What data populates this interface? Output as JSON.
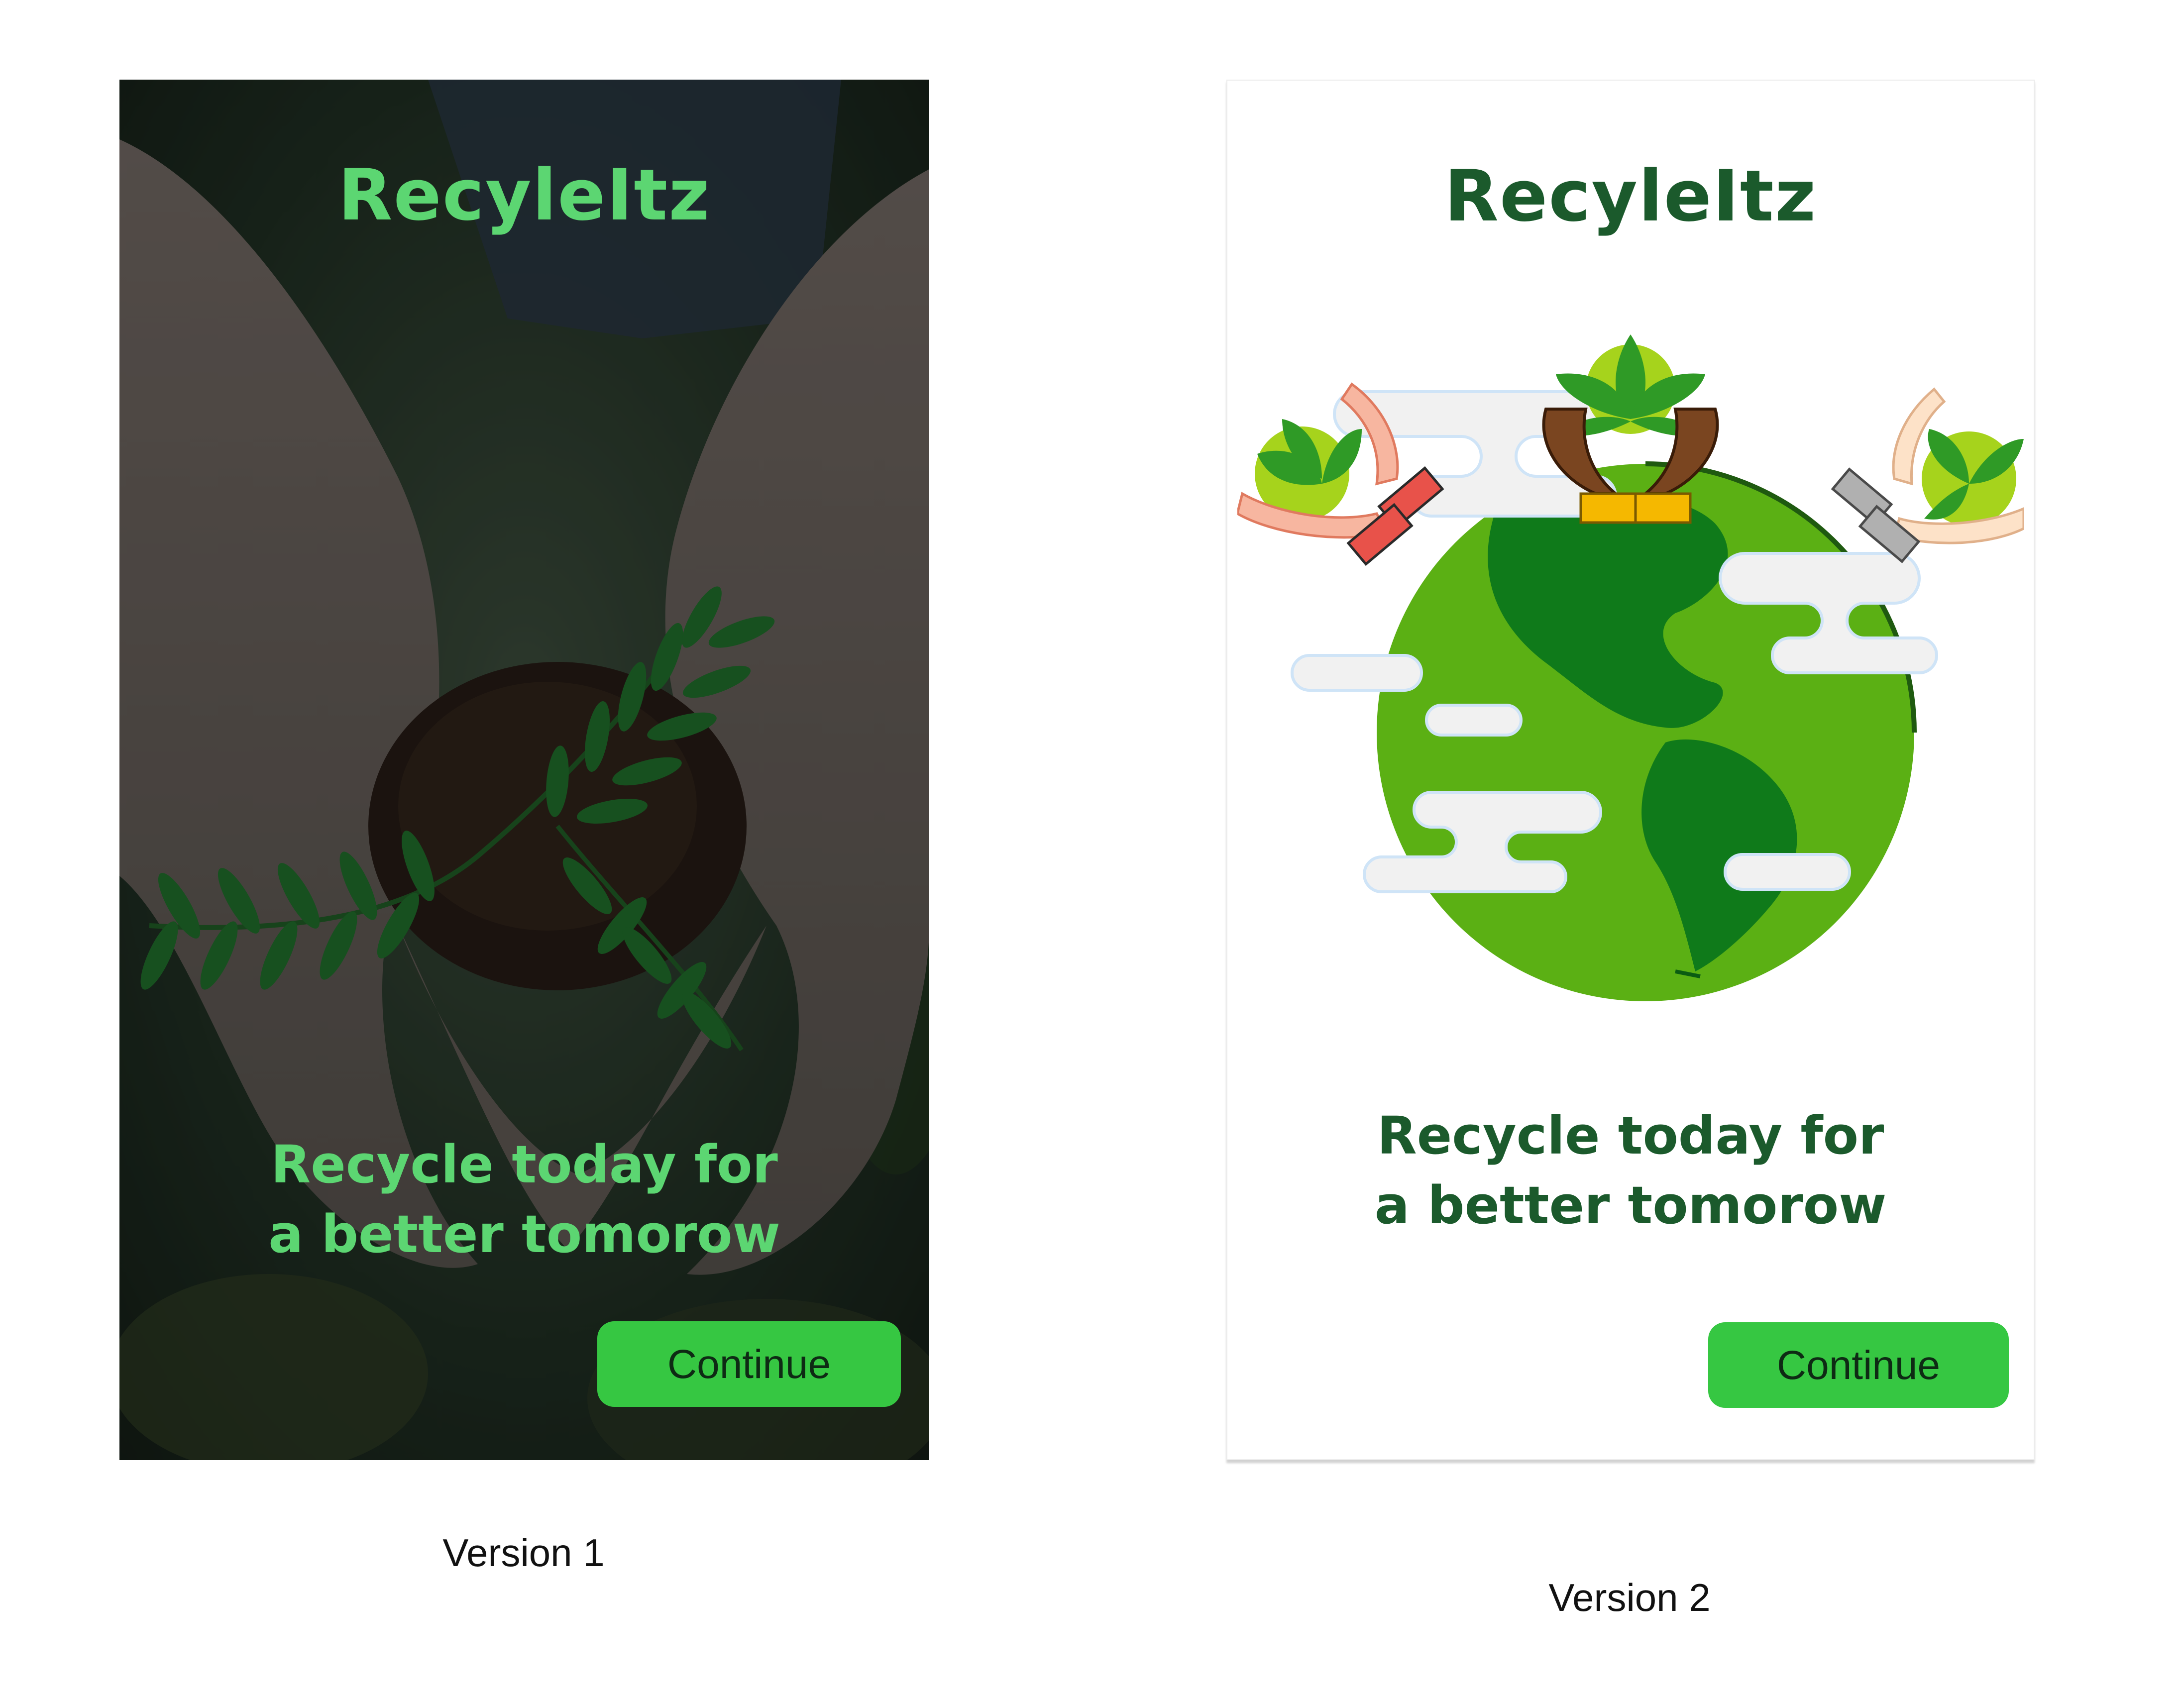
{
  "versions": [
    {
      "app_title": "RecyleItz",
      "tagline_line1": "Recycle today for",
      "tagline_line2": "a better tomorow",
      "continue_label": "Continue",
      "caption": "Version 1"
    },
    {
      "app_title": "RecyleItz",
      "tagline_line1": "Recycle today for",
      "tagline_line2": "a better tomorow",
      "continue_label": "Continue",
      "caption": "Version 2"
    }
  ],
  "colors": {
    "v1_title": "#5cd672",
    "v2_title": "#1b5a2c",
    "button": "#36c742",
    "button_text": "#0e2a14",
    "globe_ocean": "#5bb014",
    "globe_land": "#0f7a1a"
  },
  "icons": {
    "v1_background": "hands-holding-seedling-photo",
    "v2_illustration": "earth-globe-with-hands-and-plants-illustration"
  }
}
